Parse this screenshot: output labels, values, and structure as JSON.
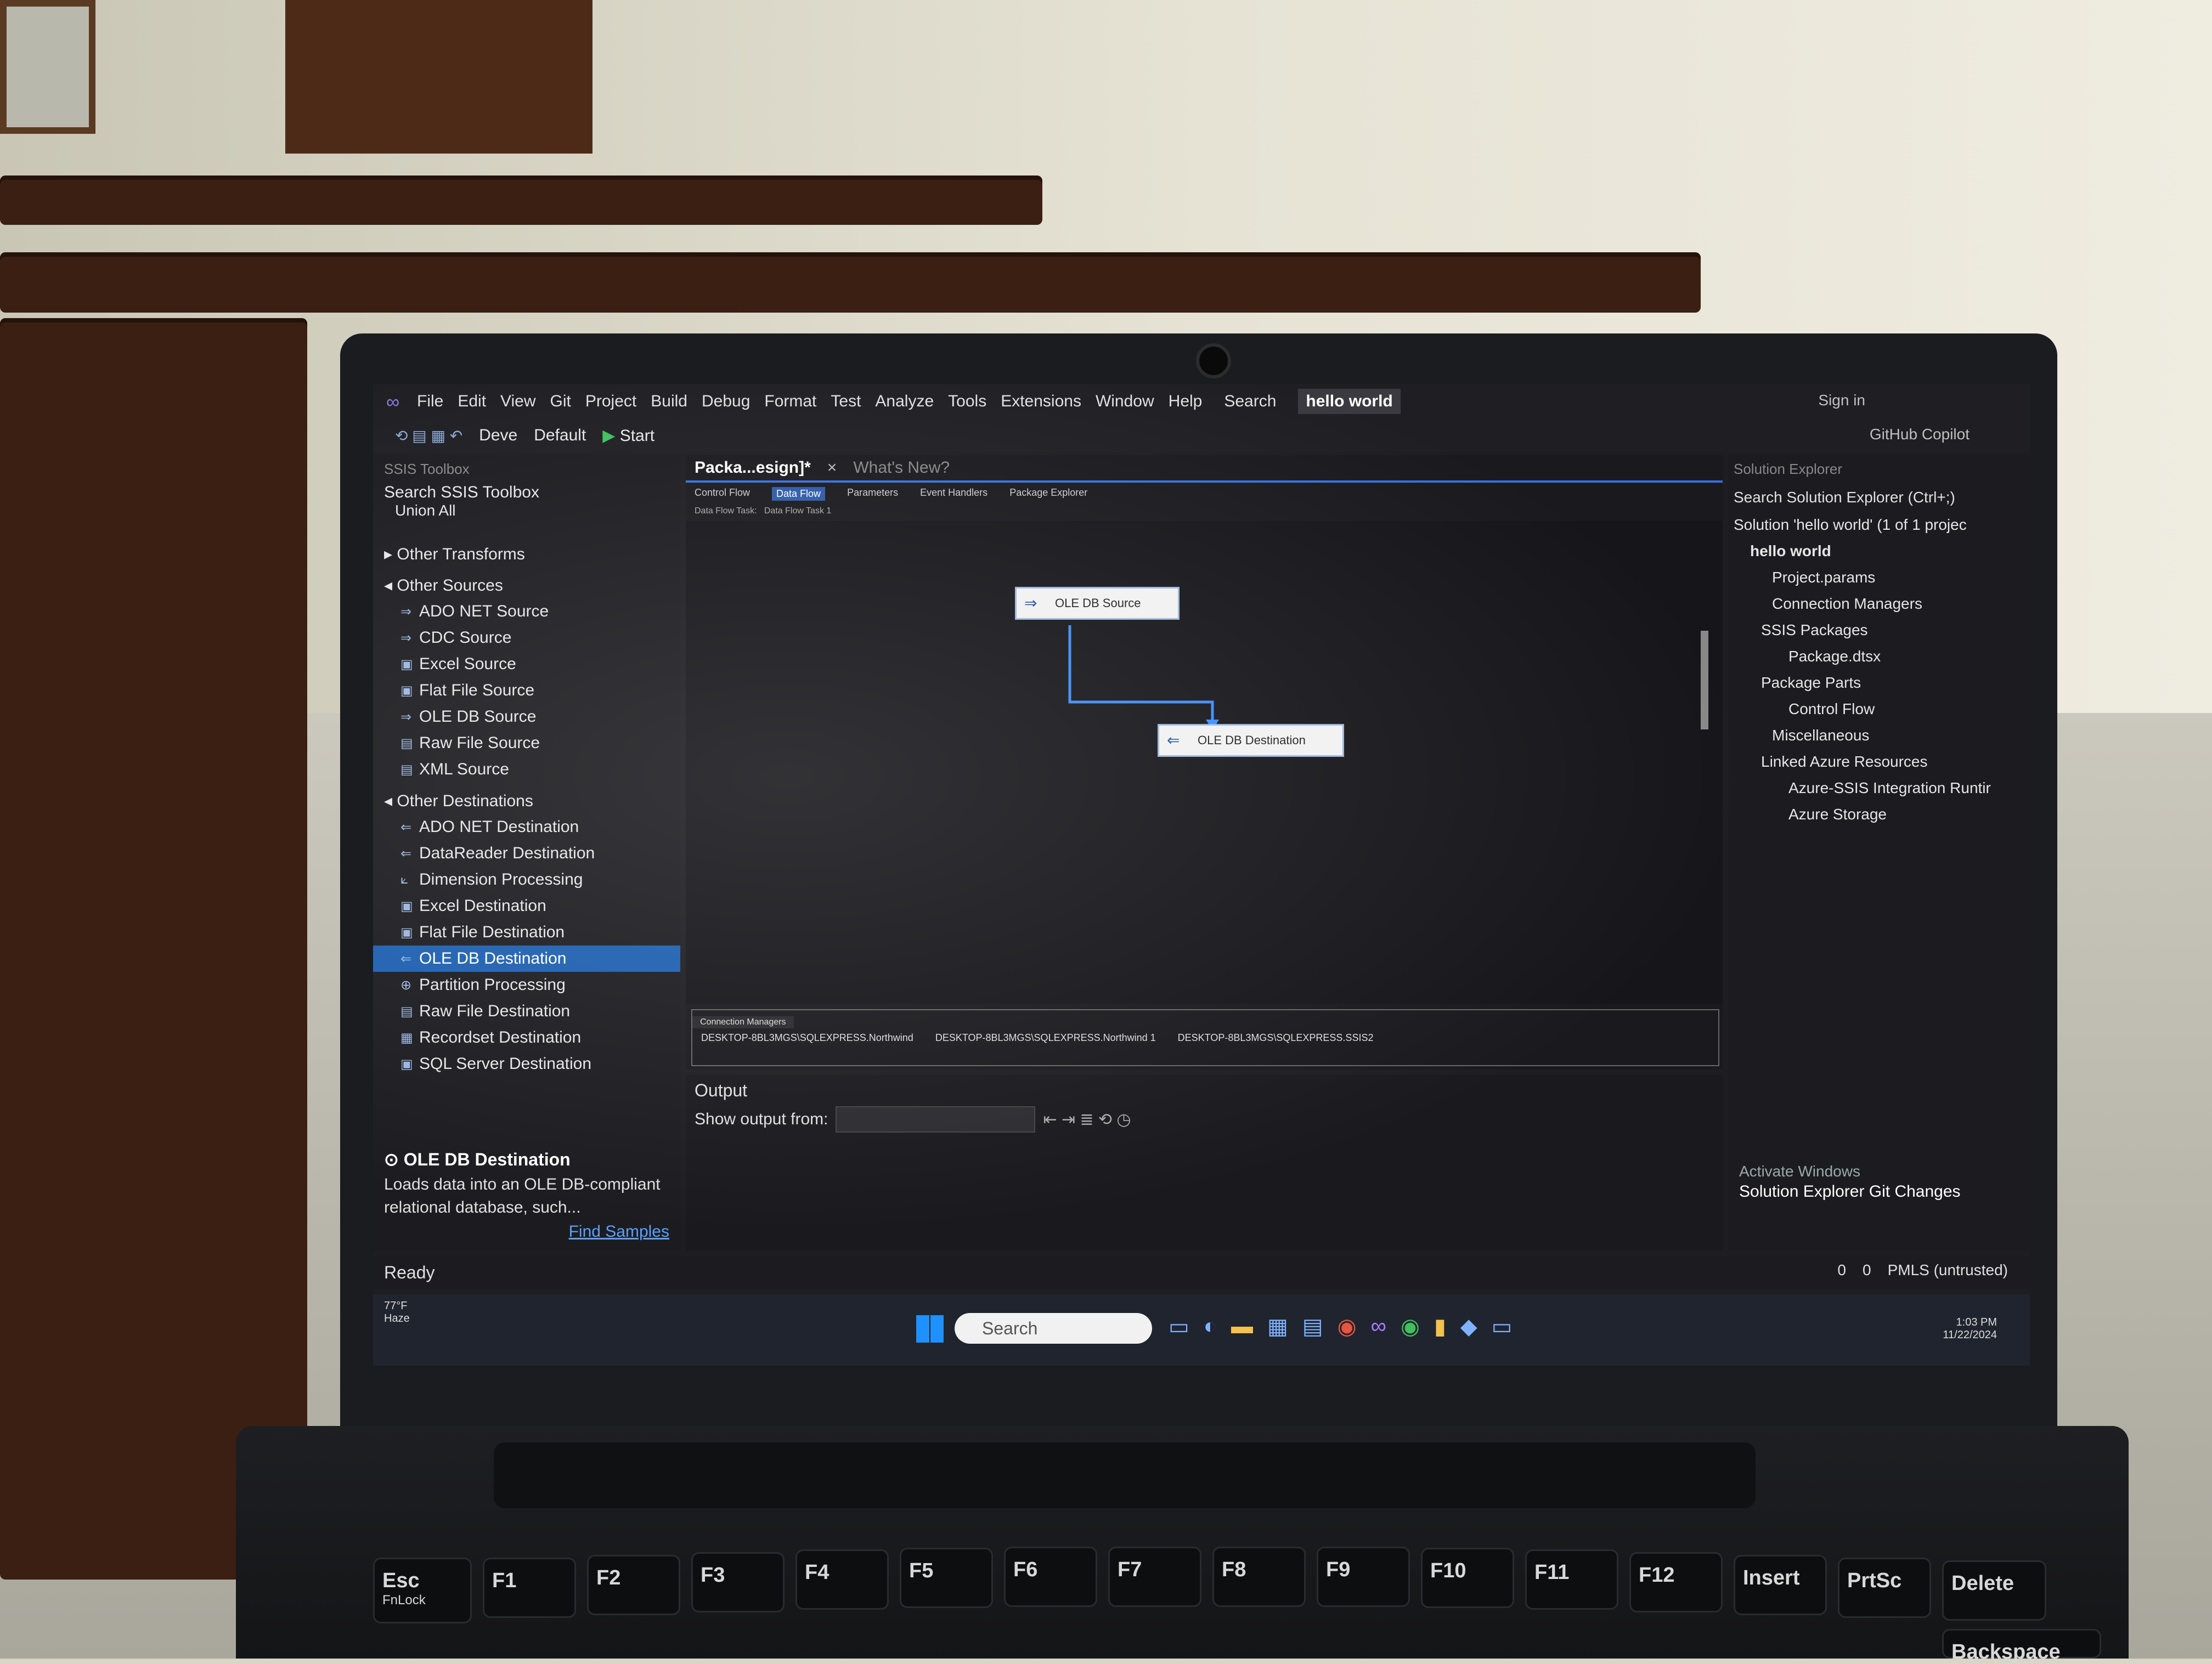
{
  "menu": [
    "File",
    "Edit",
    "View",
    "Git",
    "Project",
    "Build",
    "Debug",
    "Format",
    "Test",
    "Analyze",
    "Tools",
    "Extensions",
    "Window",
    "Help"
  ],
  "search_label": "Search",
  "solution_name": "hello world",
  "sign_in": "Sign in",
  "copilot": "GitHub Copilot",
  "toolbar": {
    "config1": "Deve",
    "config2": "Default",
    "start": "Start"
  },
  "toolbox": {
    "title": "SSIS Toolbox",
    "search": "Search SSIS Toolbox",
    "union": "Union All",
    "other_transforms": "Other Transforms",
    "other_sources": "Other Sources",
    "sources": [
      "ADO NET Source",
      "CDC Source",
      "Excel Source",
      "Flat File Source",
      "OLE DB Source",
      "Raw File Source",
      "XML Source"
    ],
    "other_destinations": "Other Destinations",
    "destinations": [
      "ADO NET Destination",
      "DataReader Destination",
      "Dimension Processing",
      "Excel Destination",
      "Flat File Destination",
      "OLE DB Destination",
      "Partition Processing",
      "Raw File Destination",
      "Recordset Destination",
      "SQL Server Destination"
    ],
    "desc_title": "OLE DB Destination",
    "desc_text": "Loads data into an OLE DB-compliant relational database, such...",
    "find_samples": "Find Samples"
  },
  "doc": {
    "tab": "Packa...esign]*",
    "tab2": "What's New?",
    "design_tabs": [
      "Control Flow",
      "Data Flow",
      "Parameters",
      "Event Handlers",
      "Package Explorer"
    ],
    "sub1": "Data Flow Task:",
    "sub2": "Data Flow Task 1",
    "node_source": "OLE DB Source",
    "node_dest": "OLE DB Destination",
    "conn_title": "Connection Managers",
    "conns": [
      "DESKTOP-8BL3MGS\\SQLEXPRESS.Northwind",
      "DESKTOP-8BL3MGS\\SQLEXPRESS.Northwind 1",
      "DESKTOP-8BL3MGS\\SQLEXPRESS.SSIS2"
    ]
  },
  "output": {
    "title": "Output",
    "show_from": "Show output from:"
  },
  "solution_explorer": {
    "title": "Solution Explorer",
    "search": "Search Solution Explorer (Ctrl+;)",
    "items": [
      "Solution 'hello world' (1 of 1 projec",
      "hello world",
      "Project.params",
      "Connection Managers",
      "SSIS Packages",
      "Package.dtsx",
      "Package Parts",
      "Control Flow",
      "Miscellaneous",
      "Linked Azure Resources",
      "Azure-SSIS Integration Runtir",
      "Azure Storage"
    ],
    "activate": "Activate Windows",
    "tabs": "Solution Explorer  Git Changes"
  },
  "status": {
    "ready": "Ready",
    "errors": "0",
    "warnings": "0",
    "repo": "PMLS (untrusted)"
  },
  "taskbar": {
    "search": "Search",
    "weather_temp": "77°F",
    "weather_desc": "Haze",
    "time": "1:03 PM",
    "date": "11/22/2024"
  },
  "keys": [
    "Esc",
    "F1",
    "F2",
    "F3",
    "F4",
    "F5",
    "F6",
    "F7",
    "F8",
    "F9",
    "F10",
    "F11",
    "F12",
    "Insert",
    "PrtSc",
    "Delete",
    "Backspace"
  ],
  "key_sub": {
    "esc": "FnLock"
  }
}
